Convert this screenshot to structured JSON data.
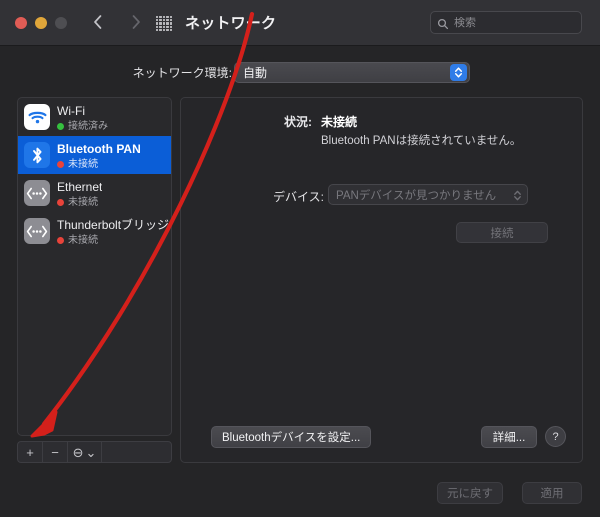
{
  "window": {
    "title": "ネットワーク",
    "traffic_lights": [
      "close",
      "minimize",
      "zoom"
    ]
  },
  "toolbar": {
    "back_icon": "chevron-left-icon",
    "forward_icon": "chevron-right-icon",
    "grid_icon": "grid-apps-icon",
    "search": {
      "placeholder": "検索",
      "value": "",
      "icon": "search-icon"
    }
  },
  "location": {
    "label": "ネットワーク環境:",
    "value": "自動",
    "options": [
      "自動"
    ],
    "accent_color": "#2f7ce8"
  },
  "sidebar": {
    "services": [
      {
        "name": "Wi-Fi",
        "status": "接続済み",
        "status_color": "#35c03f",
        "icon": "wifi-icon",
        "selected": false
      },
      {
        "name": "Bluetooth PAN",
        "status": "未接続",
        "status_color": "#e8433a",
        "icon": "bluetooth-icon",
        "selected": true
      },
      {
        "name": "Ethernet",
        "status": "未接続",
        "status_color": "#e8433a",
        "icon": "ethernet-icon",
        "selected": false
      },
      {
        "name": "Thunderboltブリッジ",
        "status": "未接続",
        "status_color": "#e8433a",
        "icon": "ethernet-icon",
        "selected": false
      }
    ],
    "toolbar": {
      "add_label": "+",
      "remove_label": "−",
      "action_label": "⊖",
      "action_chevron": "⌄"
    }
  },
  "detail": {
    "status_label": "状況:",
    "status_value": "未接続",
    "status_description": "Bluetooth PANは接続されていません。",
    "device_label": "デバイス:",
    "device_value": "PANデバイスが見つかりません",
    "device_options": [
      "PANデバイスが見つかりません"
    ],
    "connect_label": "接続",
    "setup_bluetooth_label": "Bluetoothデバイスを設定...",
    "advanced_label": "詳細...",
    "help_label": "?"
  },
  "footer": {
    "revert_label": "元に戻す",
    "apply_label": "適用"
  },
  "annotation": {
    "type": "arrow",
    "color": "#d4201b",
    "from": "title-bar",
    "to": "add-service-button"
  }
}
